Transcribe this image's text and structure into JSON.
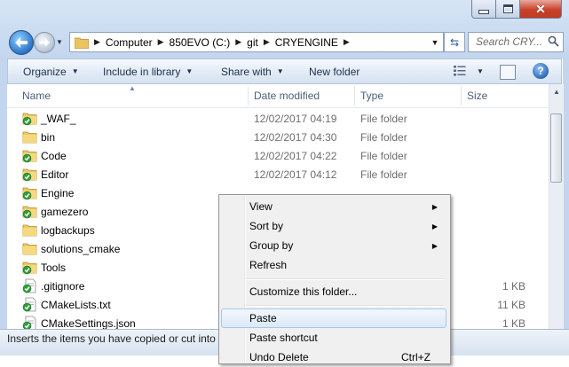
{
  "window": {
    "colors": {
      "frame": "#c4d6ee",
      "close": "#c8422a"
    }
  },
  "address": {
    "segments": [
      "Computer",
      "850EVO (C:)",
      "git",
      "CRYENGINE"
    ]
  },
  "search": {
    "placeholder": "Search CRY..."
  },
  "toolbar": {
    "organize": "Organize",
    "include": "Include in library",
    "share": "Share with",
    "new_folder": "New folder"
  },
  "columns": {
    "name": "Name",
    "date": "Date modified",
    "type": "Type",
    "size": "Size"
  },
  "rows": [
    {
      "name": "_WAF_",
      "date": "12/02/2017 04:19",
      "type": "File folder",
      "size": "",
      "icon": "folder-synced-icon"
    },
    {
      "name": "bin",
      "date": "12/02/2017 04:30",
      "type": "File folder",
      "size": "",
      "icon": "folder-icon"
    },
    {
      "name": "Code",
      "date": "12/02/2017 04:22",
      "type": "File folder",
      "size": "",
      "icon": "folder-synced-icon"
    },
    {
      "name": "Editor",
      "date": "12/02/2017 04:12",
      "type": "File folder",
      "size": "",
      "icon": "folder-synced-icon"
    },
    {
      "name": "Engine",
      "date": "",
      "type": "",
      "size": "",
      "icon": "folder-synced-icon"
    },
    {
      "name": "gamezero",
      "date": "",
      "type": "",
      "size": "",
      "icon": "folder-synced-icon"
    },
    {
      "name": "logbackups",
      "date": "",
      "type": "",
      "size": "",
      "icon": "folder-icon"
    },
    {
      "name": "solutions_cmake",
      "date": "",
      "type": "",
      "size": "",
      "icon": "folder-icon"
    },
    {
      "name": "Tools",
      "date": "",
      "type": "",
      "size": "",
      "icon": "folder-synced-icon"
    },
    {
      "name": ".gitignore",
      "date": "",
      "type": "",
      "size": "1 KB",
      "icon": "file-synced-icon"
    },
    {
      "name": "CMakeLists.txt",
      "date": "",
      "type": "",
      "size": "11 KB",
      "icon": "file-synced-icon"
    },
    {
      "name": "CMakeSettings.json",
      "date": "",
      "type": "",
      "size": "1 KB",
      "icon": "file-synced-icon"
    }
  ],
  "status": {
    "text": "Inserts the items you have copied or cut into"
  },
  "context_menu": {
    "items": [
      {
        "label": "View",
        "submenu": true
      },
      {
        "label": "Sort by",
        "submenu": true
      },
      {
        "label": "Group by",
        "submenu": true
      },
      {
        "label": "Refresh",
        "submenu": false
      },
      {
        "label": "Customize this folder...",
        "submenu": false
      },
      {
        "label": "Paste",
        "submenu": false,
        "highlighted": true
      },
      {
        "label": "Paste shortcut",
        "submenu": false
      },
      {
        "label": "Undo Delete",
        "shortcut": "Ctrl+Z"
      }
    ]
  }
}
